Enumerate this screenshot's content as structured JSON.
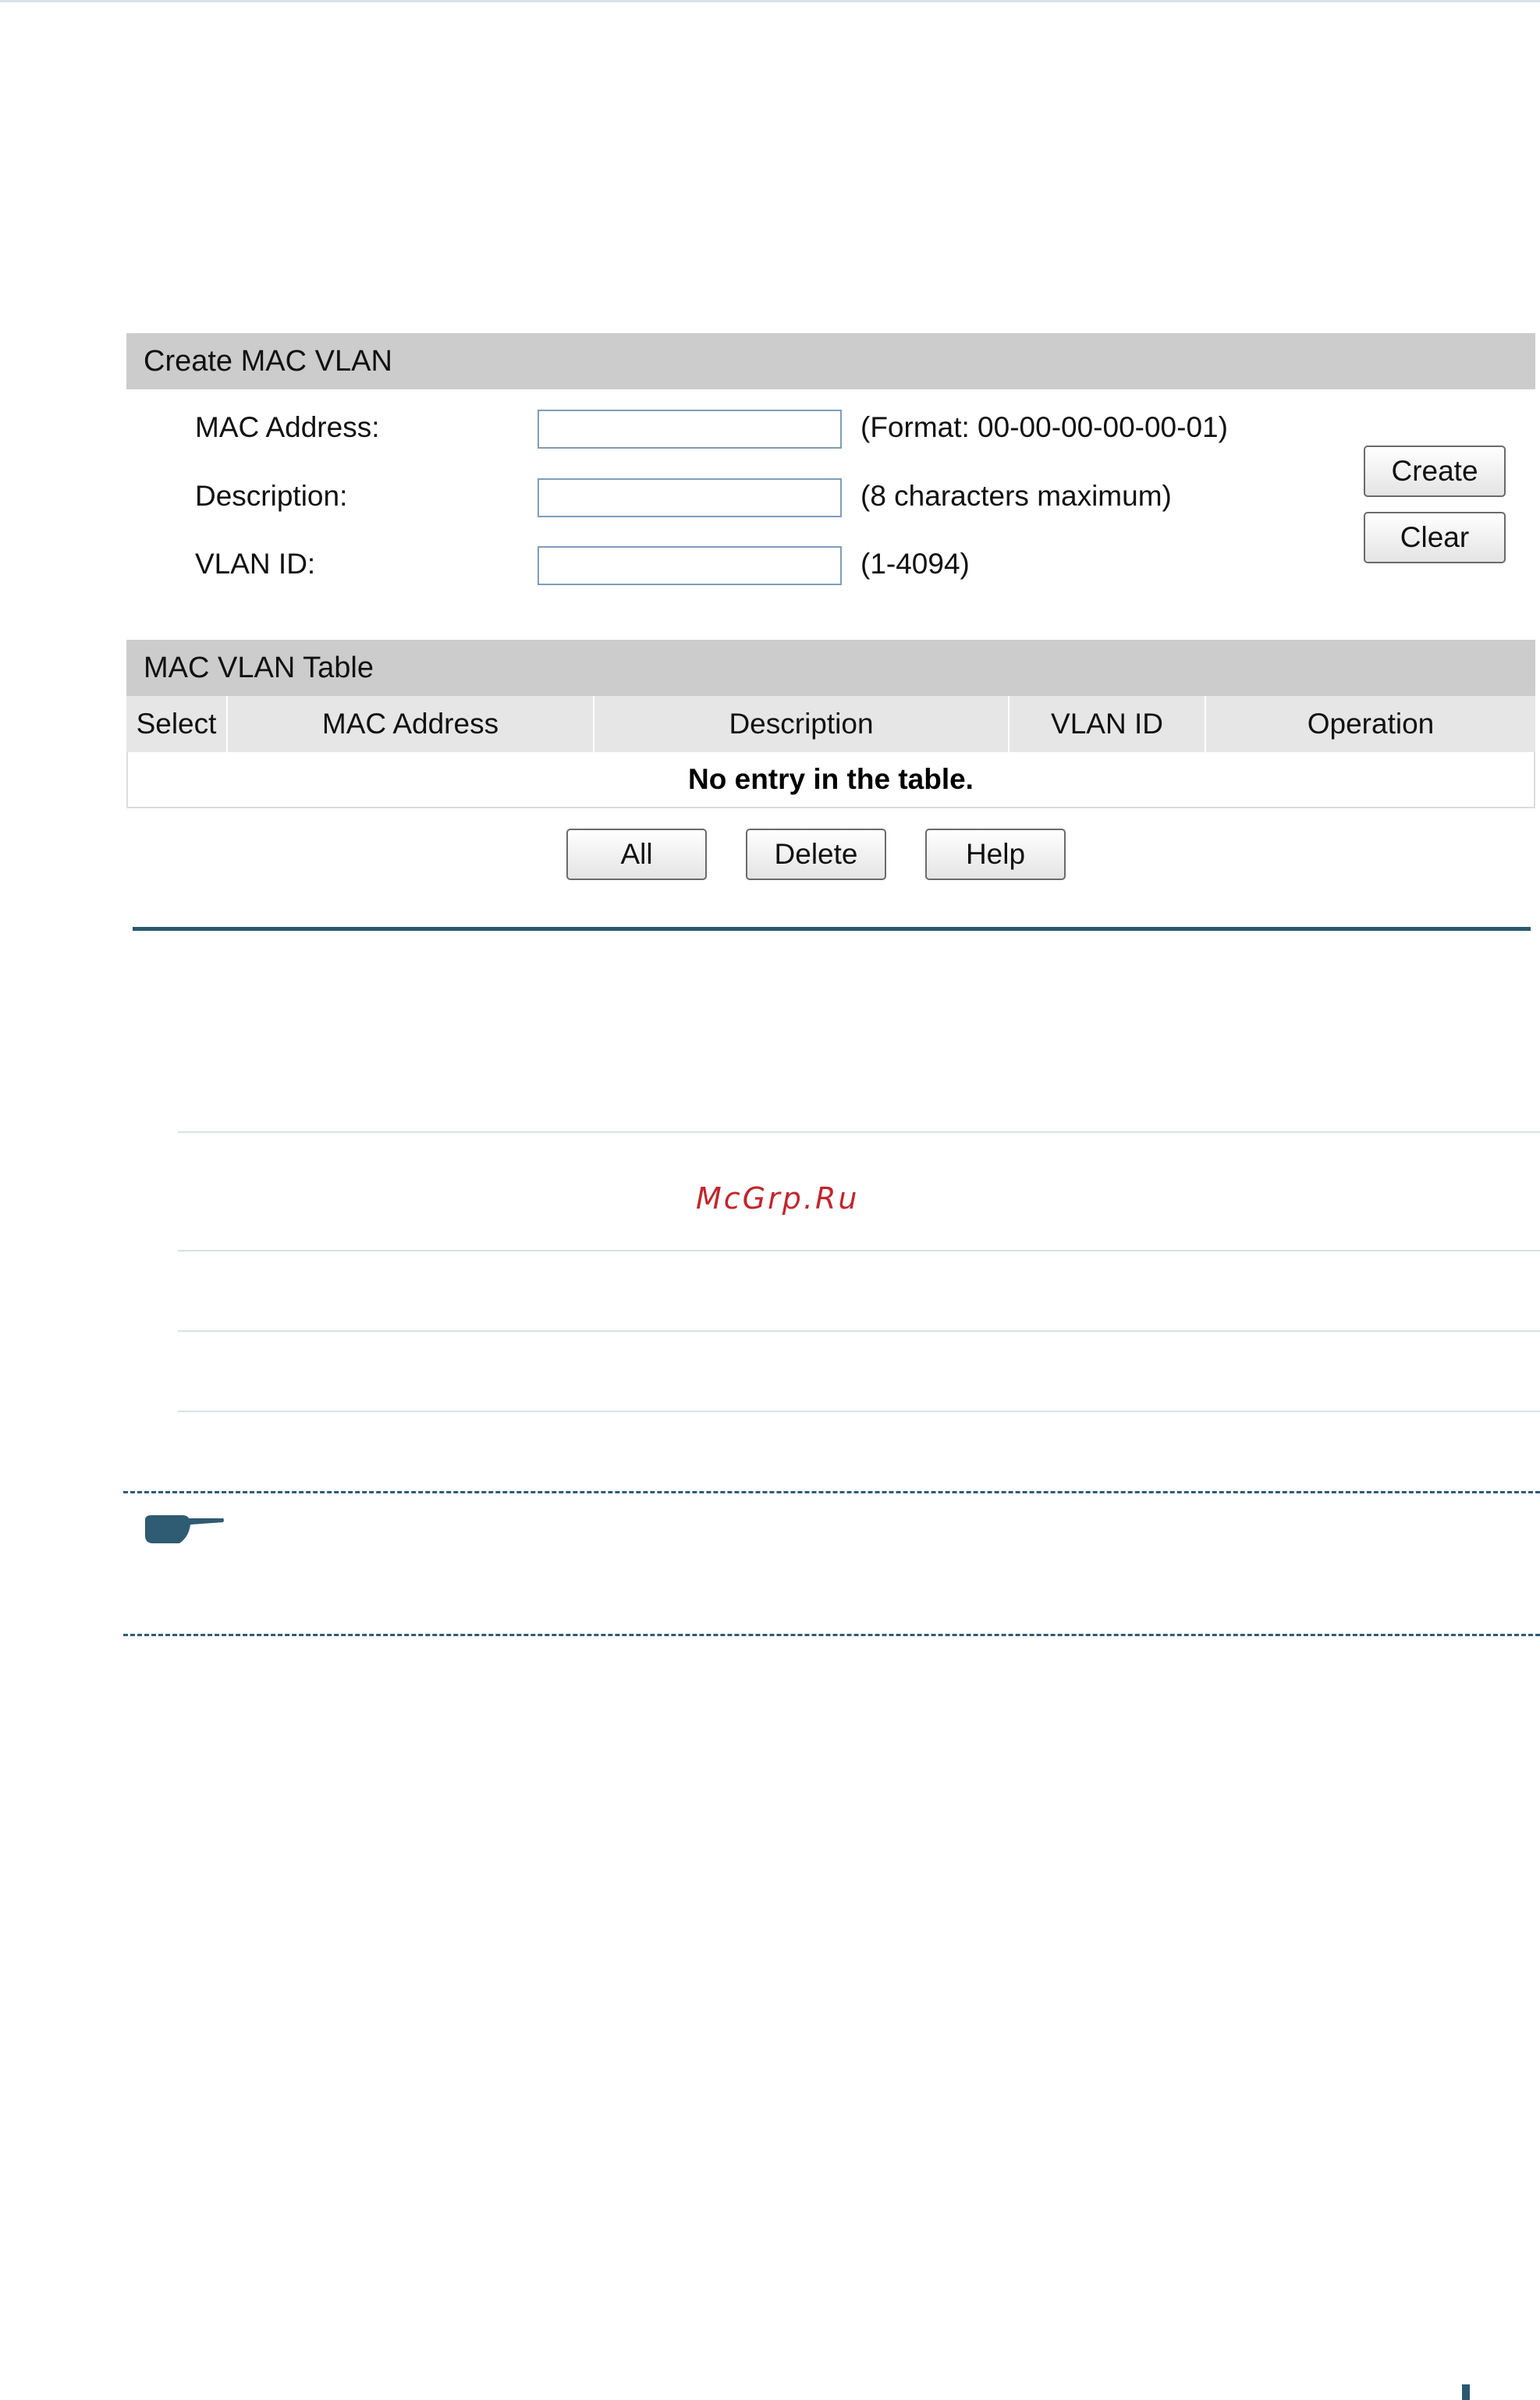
{
  "create_panel": {
    "title": "Create MAC VLAN",
    "fields": [
      {
        "label": "MAC Address:",
        "value": "",
        "hint": "(Format: 00-00-00-00-00-01)"
      },
      {
        "label": "Description:",
        "value": "",
        "hint": "(8 characters maximum)"
      },
      {
        "label": "VLAN ID:",
        "value": "",
        "hint": "(1-4094)"
      }
    ],
    "create_label": "Create",
    "clear_label": "Clear"
  },
  "table_panel": {
    "title": "MAC VLAN Table",
    "columns": [
      "Select",
      "MAC Address",
      "Description",
      "VLAN ID",
      "Operation"
    ],
    "empty_message": "No entry in the table.",
    "all_label": "All",
    "delete_label": "Delete",
    "help_label": "Help"
  },
  "watermark": "McGrp.Ru",
  "icons": {
    "note": "pointing-hand-icon"
  },
  "colors": {
    "header_bg": "#cccccc",
    "rule": "#2a5770",
    "watermark": "#c0272d"
  }
}
